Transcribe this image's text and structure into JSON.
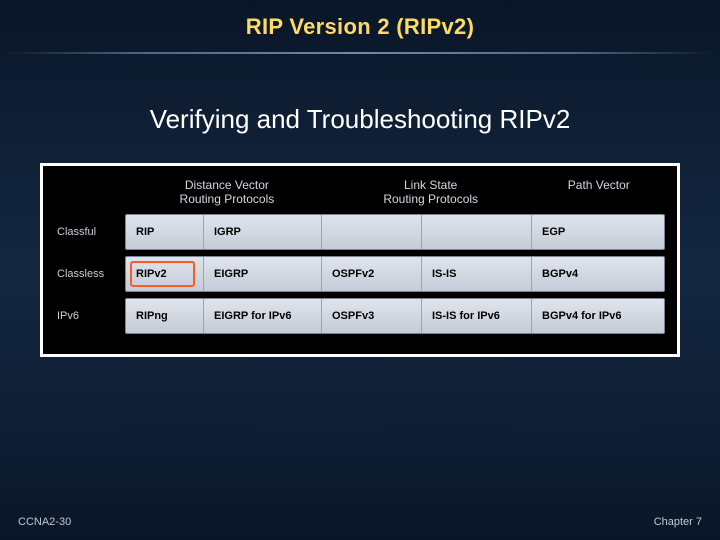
{
  "title": "RIP Version 2 (RIPv2)",
  "subtitle": "Verifying and Troubleshooting RIPv2",
  "headers": {
    "dv_line1": "Distance Vector",
    "dv_line2": "Routing Protocols",
    "ls_line1": "Link State",
    "ls_line2": "Routing Protocols",
    "pv_line1": "Path Vector"
  },
  "rows": {
    "classful": {
      "label": "Classful",
      "c0": "RIP",
      "c1": "IGRP",
      "c2": "",
      "c3": "",
      "c4": "EGP"
    },
    "classless": {
      "label": "Classless",
      "c0": "RIPv2",
      "c1": "EIGRP",
      "c2": "OSPFv2",
      "c3": "IS-IS",
      "c4": "BGPv4"
    },
    "ipv6": {
      "label": "IPv6",
      "c0": "RIPng",
      "c1": "EIGRP for IPv6",
      "c2": "OSPFv3",
      "c3": "IS-IS for IPv6",
      "c4": "BGPv4 for IPv6"
    }
  },
  "footer": {
    "left": "CCNA2-30",
    "right": "Chapter 7"
  }
}
